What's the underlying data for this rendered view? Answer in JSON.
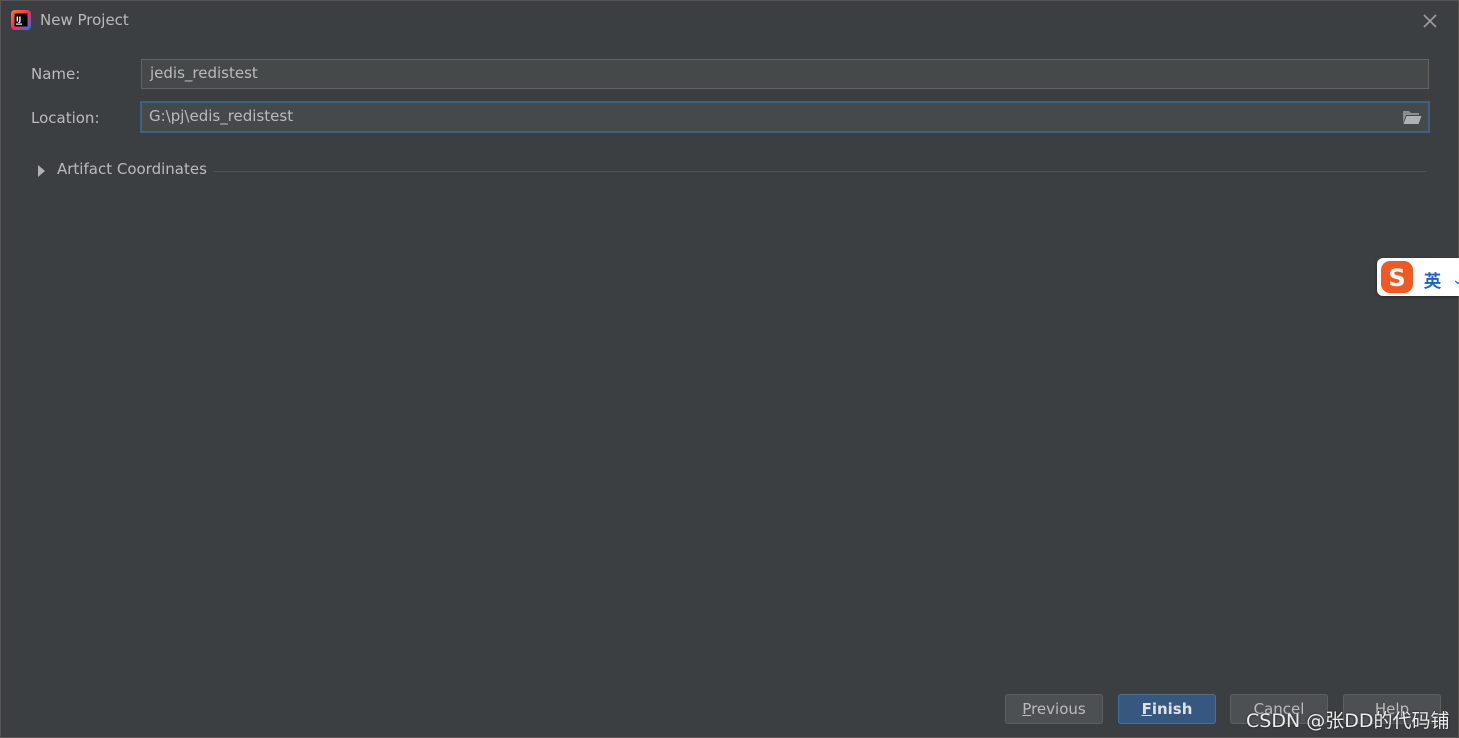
{
  "window": {
    "title": "New Project"
  },
  "form": {
    "name_label": "Name:",
    "name_value": "jedis_redistest",
    "location_label": "Location:",
    "location_value": "G:\\pj\\edis_redistest"
  },
  "section": {
    "label": "Artifact Coordinates",
    "expanded": false
  },
  "buttons": {
    "previous": {
      "mnemonic": "P",
      "rest": "revious"
    },
    "finish": {
      "mnemonic": "F",
      "rest": "inish"
    },
    "cancel": {
      "label": "Cancel"
    },
    "help": {
      "label": "Help"
    }
  },
  "ime": {
    "mode": "英",
    "arrow": "⌄"
  },
  "watermark": "CSDN @张DD的代码铺",
  "colors": {
    "background": "#3c3f41",
    "field_bg": "#45494a",
    "focus_border": "#3d6185",
    "primary_button": "#365880"
  }
}
